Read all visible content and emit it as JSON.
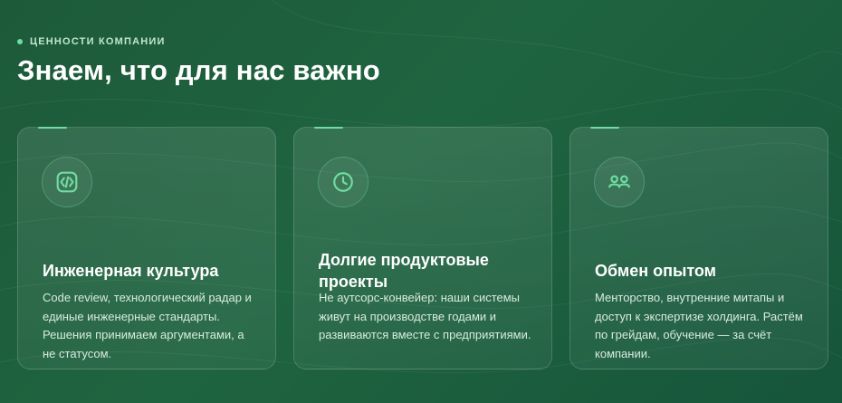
{
  "section": {
    "eyebrow": "ЦЕННОСТИ КОМПАНИИ",
    "title": "Знаем, что для нас важно"
  },
  "colors": {
    "accent": "#6fdca0",
    "background": "#1f6440"
  },
  "cards": [
    {
      "icon": "code-icon",
      "title": "Инженерная культура",
      "description": "Code review, технологический радар и единые инженерные стандарты. Решения принимаем аргументами, а не статусом."
    },
    {
      "icon": "clock-icon",
      "title": "Долгие продуктовые проекты",
      "description": "Не аутсорс-конвейер: наши системы живут на производстве годами и развиваются вместе с предприятиями."
    },
    {
      "icon": "people-icon",
      "title": "Обмен опытом",
      "description": "Менторство, внутренние митапы и доступ к экспертизе холдинга. Растём по грейдам, обучение — за счёт компании."
    }
  ]
}
